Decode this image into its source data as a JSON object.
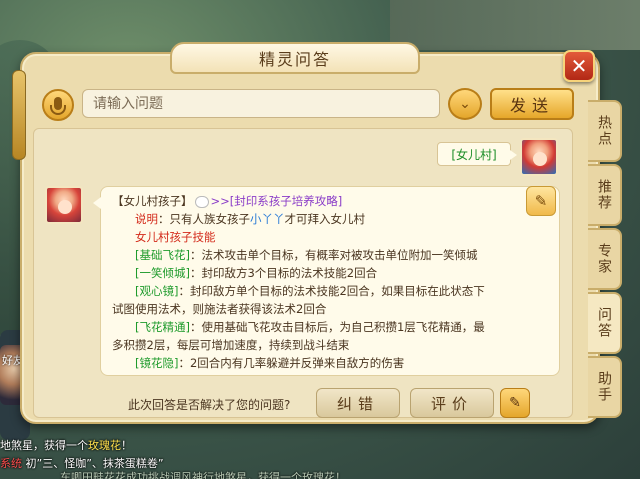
{
  "panel": {
    "title": "精灵问答"
  },
  "input": {
    "placeholder": "请输入问题",
    "send_label": "发送"
  },
  "conversation": {
    "user_message": "[女儿村]",
    "answer": {
      "heading_name": "【女儿村孩子】",
      "heading_link": ">>[封印系孩子培养攻略]",
      "note_label": "说明",
      "note_text": "：只有人族女孩子",
      "note_name": "小丫丫",
      "note_suffix": "才可拜入女儿村",
      "skills_title": "女儿村孩子技能",
      "skill1_name": "[基础飞花]",
      "skill1_text": "：法术攻击单个目标，有概率对被攻击单位附加一笑倾城",
      "skill2_name": "[一笑倾城]",
      "skill2_text": "：封印敌方3个目标的法术技能2回合",
      "skill3_name": "[观心镜]",
      "skill3_text": "：封印敌方单个目标的法术技能2回合，如果目标在此状态下",
      "skill3_text2": "试图使用法术，则施法者获得该法术2回合",
      "skill4_name": "[飞花精通]",
      "skill4_text": "：使用基础飞花攻击目标后，为自己积攒1层飞花精通，最",
      "skill4_text2": "多积攒2层，每层可增加速度，持续到战斗结束",
      "skill5_name": "[镜花隐]",
      "skill5_text": "：2回合内有几率躲避并反弹来自敌方的伤害"
    },
    "feedback_question": "此次回答是否解决了您的问题?",
    "correct_label": "纠错",
    "rate_label": "评价"
  },
  "side_tabs": [
    "热点",
    "推荐",
    "专家",
    "问答",
    "助手"
  ],
  "background": {
    "side_hint": "好友",
    "chat_line1_prefix": "地煞星，获得一个",
    "chat_line1_item": "玫瑰花",
    "chat_line1_suffix": "！",
    "chat_line2_tag": "系统",
    "chat_line2_text": "初”三、怪咖”、抹茶蛋糕卷”",
    "chat_line3_text": "车唧田畦花花成功挑战调风神行地煞星，获得一个玫瑰花！"
  },
  "colors": {
    "panel_bg": "#ecdcae",
    "green_text": "#1f9b2c",
    "red_text": "#d32a1a",
    "purple_link": "#8a3cc8",
    "close_red": "#c8341d",
    "button_gold": "#e6a72a"
  },
  "icons": {
    "mic": "microphone-icon",
    "dropdown": "chevron-down-icon",
    "close": "close-icon",
    "hint": "scroll-icon",
    "edit": "edit-icon"
  }
}
